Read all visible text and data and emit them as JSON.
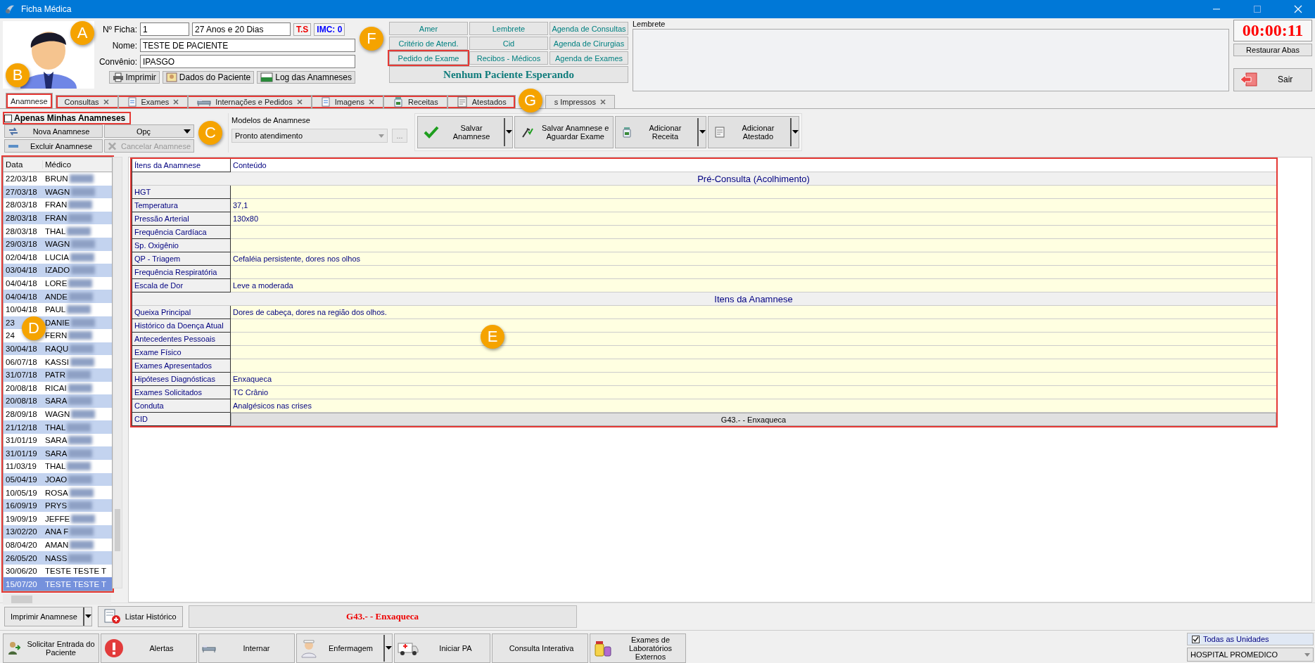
{
  "window": {
    "title": "Ficha Médica"
  },
  "patient": {
    "ficha_label": "Nº Ficha:",
    "ficha": "1",
    "age": "27 Anos e 20 Dias",
    "ts": "T.S",
    "imc": "IMC: 0",
    "name_label": "Nome:",
    "name": "TESTE DE PACIENTE",
    "insurance_label": "Convênio:",
    "insurance": "IPASGO"
  },
  "patient_buttons": [
    "Imprimir",
    "Dados do Paciente",
    "Log das Anamneses"
  ],
  "shortcuts": [
    {
      "label": "Amer",
      "highlighted": false
    },
    {
      "label": "Lembrete",
      "highlighted": false
    },
    {
      "label": "Agenda de Consultas",
      "highlighted": false
    },
    {
      "label": "Critério de Atend.",
      "highlighted": false
    },
    {
      "label": "Cid",
      "highlighted": false
    },
    {
      "label": "Agenda de Cirurgias",
      "highlighted": false
    },
    {
      "label": "Pedido de Exame",
      "highlighted": true
    },
    {
      "label": "Recibos - Médicos",
      "highlighted": false
    },
    {
      "label": "Agenda de Exames",
      "highlighted": false
    }
  ],
  "waiting": "Nenhum Paciente Esperando",
  "reminder": {
    "label": "Lembrete"
  },
  "timer": "00:00:11",
  "restore_button": "Restaurar Abas",
  "exit_button": "Sair",
  "tabs": [
    {
      "label": "Anamnese",
      "selected": true,
      "closable": false,
      "highlighted": true
    },
    {
      "label": "Consultas",
      "selected": false,
      "closable": true,
      "highlighted": true
    },
    {
      "label": "Exames",
      "selected": false,
      "closable": true,
      "highlighted": true
    },
    {
      "label": "Internações e Pedidos",
      "selected": false,
      "closable": true,
      "highlighted": true
    },
    {
      "label": "Imagens",
      "selected": false,
      "closable": true,
      "highlighted": true
    },
    {
      "label": "Receitas",
      "selected": false,
      "closable": false,
      "highlighted": true
    },
    {
      "label": "Atestados",
      "selected": false,
      "closable": false,
      "highlighted": true
    },
    {
      "label": "s Impressos",
      "selected": false,
      "closable": true,
      "highlighted": false
    }
  ],
  "only_mine": {
    "label": "Apenas Minhas Anamneses",
    "checked": false,
    "highlighted": true
  },
  "anamnese_buttons": [
    {
      "label": "Nova Anamnese",
      "disabled": false
    },
    {
      "label": "Opç",
      "disabled": false,
      "dropdown": true
    },
    {
      "label": "Excluir Anamnese",
      "disabled": false
    },
    {
      "label": "Cancelar Anamnese",
      "disabled": true
    }
  ],
  "models": {
    "label": "Modelos de Anamnese",
    "value": "Pronto atendimento",
    "more": "..."
  },
  "actions": [
    {
      "lines": [
        "Salvar",
        "Anamnese"
      ],
      "dropdown": true
    },
    {
      "lines": [
        "Salvar Anamnese e",
        "Aguardar Exame"
      ],
      "dropdown": false
    },
    {
      "lines": [
        "Adicionar",
        "Receita"
      ],
      "dropdown": true
    },
    {
      "lines": [
        "Adicionar",
        "Atestado"
      ],
      "dropdown": true
    }
  ],
  "history": {
    "highlighted": true,
    "columns": [
      "Data",
      "Médico"
    ],
    "rows": [
      {
        "date": "22/03/18",
        "doctor": "BRUN",
        "redacted": true,
        "selected": false
      },
      {
        "date": "27/03/18",
        "doctor": "WAGN",
        "redacted": true,
        "selected": false
      },
      {
        "date": "28/03/18",
        "doctor": "FRAN",
        "redacted": true,
        "selected": false
      },
      {
        "date": "28/03/18",
        "doctor": "FRAN",
        "redacted": true,
        "selected": false
      },
      {
        "date": "28/03/18",
        "doctor": "THAL",
        "redacted": true,
        "selected": false
      },
      {
        "date": "29/03/18",
        "doctor": "WAGN",
        "redacted": true,
        "selected": false
      },
      {
        "date": "02/04/18",
        "doctor": "LUCIA",
        "redacted": true,
        "selected": false
      },
      {
        "date": "03/04/18",
        "doctor": "IZADO",
        "redacted": true,
        "selected": false
      },
      {
        "date": "04/04/18",
        "doctor": "LORE",
        "redacted": true,
        "selected": false
      },
      {
        "date": "04/04/18",
        "doctor": "ANDE",
        "redacted": true,
        "selected": false
      },
      {
        "date": "10/04/18",
        "doctor": "PAUL",
        "redacted": true,
        "selected": false
      },
      {
        "date": "23",
        "doctor": "DANIE",
        "redacted": true,
        "selected": false
      },
      {
        "date": "24",
        "doctor": "FERN",
        "redacted": true,
        "selected": false
      },
      {
        "date": "30/04/18",
        "doctor": "RAQU",
        "redacted": true,
        "selected": false
      },
      {
        "date": "06/07/18",
        "doctor": "KASSI",
        "redacted": true,
        "selected": false
      },
      {
        "date": "31/07/18",
        "doctor": "PATR",
        "redacted": true,
        "selected": false
      },
      {
        "date": "20/08/18",
        "doctor": "RICAI",
        "redacted": true,
        "selected": false
      },
      {
        "date": "20/08/18",
        "doctor": "SARA",
        "redacted": true,
        "selected": false
      },
      {
        "date": "28/09/18",
        "doctor": "WAGN",
        "redacted": true,
        "selected": false
      },
      {
        "date": "21/12/18",
        "doctor": "THAL",
        "redacted": true,
        "selected": false
      },
      {
        "date": "31/01/19",
        "doctor": "SARA",
        "redacted": true,
        "selected": false
      },
      {
        "date": "31/01/19",
        "doctor": "SARA",
        "redacted": true,
        "selected": false
      },
      {
        "date": "11/03/19",
        "doctor": "THAL",
        "redacted": true,
        "selected": false
      },
      {
        "date": "05/04/19",
        "doctor": "JOAO",
        "redacted": true,
        "selected": false
      },
      {
        "date": "10/05/19",
        "doctor": "ROSA",
        "redacted": true,
        "selected": false
      },
      {
        "date": "16/09/19",
        "doctor": "PRYS",
        "redacted": true,
        "selected": false
      },
      {
        "date": "19/09/19",
        "doctor": "JEFFE",
        "redacted": true,
        "selected": false
      },
      {
        "date": "13/02/20",
        "doctor": "ANA F",
        "redacted": true,
        "selected": false
      },
      {
        "date": "08/04/20",
        "doctor": "AMAN",
        "redacted": true,
        "selected": false
      },
      {
        "date": "26/05/20",
        "doctor": "NASS",
        "redacted": true,
        "selected": false
      },
      {
        "date": "30/06/20",
        "doctor": "TESTE TESTE T",
        "redacted": false,
        "selected": false
      },
      {
        "date": "15/07/20",
        "doctor": "TESTE TESTE T",
        "redacted": false,
        "selected": true
      }
    ]
  },
  "record": {
    "highlighted": true,
    "columns": [
      "Ítens da Anamnese",
      "Conteúdo"
    ],
    "sections": [
      {
        "title": "Pré-Consulta (Acolhimento)",
        "rows": [
          {
            "item": "HGT"
          },
          {
            "item": "Temperatura",
            "value": "37,1"
          },
          {
            "item": "Pressão Arterial",
            "value": "130x80"
          },
          {
            "item": "Frequência Cardíaca"
          },
          {
            "item": "Sp. Oxigênio"
          },
          {
            "item": "QP - Triagem",
            "value": "Cefaléia persistente, dores nos olhos"
          },
          {
            "item": "Frequência Respiratória"
          },
          {
            "item": "Escala de Dor",
            "value": "Leve a moderada"
          }
        ]
      },
      {
        "title": "Itens da Anamnese",
        "rows": [
          {
            "item": "Queixa Principal",
            "value": "Dores de cabeça, dores na região dos olhos."
          },
          {
            "item": "Histórico da Doença Atual"
          },
          {
            "item": "Antecedentes Pessoais"
          },
          {
            "item": "Exame Físico"
          },
          {
            "item": "Exames Apresentados"
          },
          {
            "item": "Hipóteses Diagnósticas",
            "value": "Enxaqueca"
          },
          {
            "item": "Exames Solicitados",
            "value": "TC Crânio"
          },
          {
            "item": "Conduta",
            "value": "Analgésicos nas crises"
          },
          {
            "item": "CID",
            "value": "G43.- - Enxaqueca",
            "kind": "cid"
          }
        ]
      }
    ]
  },
  "print_button": "Imprimir Anamnese",
  "history_button": "Listar Histórico",
  "diagnosis": "G43.- - Enxaqueca",
  "taskbar": [
    {
      "label": "Solicitar Entrada do Paciente",
      "dropdown": false
    },
    {
      "label": "Alertas",
      "dropdown": false
    },
    {
      "label": "Internar",
      "dropdown": false
    },
    {
      "label": "Enfermagem",
      "dropdown": true
    },
    {
      "label": "Iniciar PA",
      "dropdown": false
    },
    {
      "label": "Consulta Interativa",
      "dropdown": false
    },
    {
      "label": "Exames de Laboratórios Externos",
      "dropdown": false
    }
  ],
  "units": {
    "label": "Todas as Unidades",
    "checked": true
  },
  "hospital": "HOSPITAL PROMEDICO",
  "callouts": [
    "A",
    "B",
    "C",
    "D",
    "E",
    "F",
    "G"
  ]
}
